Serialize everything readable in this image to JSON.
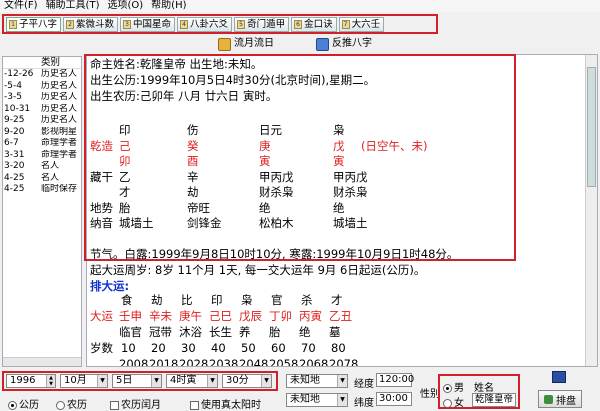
{
  "menu": [
    "文件(F)",
    "辅助工具(T)",
    "选项(O)",
    "帮助(H)"
  ],
  "tabs": [
    {
      "label": "子平八字",
      "num": "1"
    },
    {
      "label": "紫微斗数",
      "num": "2"
    },
    {
      "label": "中国星命",
      "num": "3"
    },
    {
      "label": "八卦六爻",
      "num": "4"
    },
    {
      "label": "奇门遁甲",
      "num": "5"
    },
    {
      "label": "金口诀",
      "num": "6"
    },
    {
      "label": "大六壬",
      "num": "7"
    }
  ],
  "subtoolbar": {
    "flow_label": "流月流日",
    "reverse_label": "反推八字"
  },
  "left_panel": {
    "header": "类别",
    "rows": [
      {
        "date": "-12-26",
        "cat": "历史名人"
      },
      {
        "date": "-5-4",
        "cat": "历史名人"
      },
      {
        "date": "-3-5",
        "cat": "历史名人"
      },
      {
        "date": "10-31",
        "cat": "历史名人"
      },
      {
        "date": "9-25",
        "cat": "历史名人"
      },
      {
        "date": "9-20",
        "cat": "影视明星"
      },
      {
        "date": "6-7",
        "cat": "命理学者"
      },
      {
        "date": "3-31",
        "cat": "命理学者"
      },
      {
        "date": "3-20",
        "cat": "名人"
      },
      {
        "date": "4-25",
        "cat": "名人"
      },
      {
        "date": "4-25",
        "cat": "临时保存"
      }
    ]
  },
  "chart": {
    "line1": "命主姓名:乾隆皇帝  出生地:未知。",
    "line2": "出生公历:1999年10月5日4时30分(北京时间),星期二。",
    "line3": "出生农历:己卯年 八月 廿六日 寅时。",
    "ten_gods": [
      "印",
      "伤",
      "日元",
      "枭"
    ],
    "qianzao_label": "乾造",
    "stems": [
      "己",
      "癸",
      "庚",
      "戊"
    ],
    "kong": "(日空午、未)",
    "branches": [
      "卯",
      "酉",
      "寅",
      "寅"
    ],
    "canggan_label": "藏干",
    "hidden_stems": [
      "乙",
      "辛",
      "甲丙戊",
      "甲丙戊"
    ],
    "hidden_gods": [
      "才",
      "劫",
      "财杀枭",
      "财杀枭"
    ],
    "dishi_label": "地势",
    "dishi": [
      "胎",
      "帝旺",
      "绝",
      "绝"
    ],
    "nayin_label": "纳音",
    "nayin": [
      "城墙土",
      "剑锋金",
      "松柏木",
      "城墙土"
    ],
    "jieqi": "节气。白露:1999年9月8日10时10分, 寒露:1999年10月9日1时48分。",
    "qiyun": "起大运周岁: 8岁 11个月 1天, 每一交大运年 9月 6日起运(公历)。",
    "dayun_label": "排大运:",
    "dayun_gods": [
      "食",
      "劫",
      "比",
      "印",
      "枭",
      "官",
      "杀",
      "才"
    ],
    "dayun_label2": "大运",
    "dayun_pillars": [
      "壬申",
      "辛未",
      "庚午",
      "己巳",
      "戊辰",
      "丁卯",
      "丙寅",
      "乙丑"
    ],
    "dayun_dishi": [
      "临官",
      "冠带",
      "沐浴",
      "长生",
      "养",
      "胎",
      "绝",
      "墓"
    ],
    "suishu_label": "岁数",
    "suishu": [
      "10",
      "20",
      "30",
      "40",
      "50",
      "60",
      "70",
      "80"
    ],
    "years": [
      "2008",
      "2018",
      "2028",
      "2038",
      "2048",
      "2058",
      "2068",
      "2078"
    ]
  },
  "date_inputs": {
    "year": "1996",
    "month": "10月",
    "day": "5日",
    "hour": "4时寅",
    "minute": "30分"
  },
  "calendar": {
    "solar": "公历",
    "lunar": "农历",
    "leap": "农历闰月",
    "true_solar": "使用真太阳时"
  },
  "location": {
    "place1": "未知地",
    "place2": "未知地",
    "lon_label": "经度",
    "lon": "120:00",
    "lat_label": "纬度",
    "lat": "30:00"
  },
  "gender": {
    "label": "性别",
    "male": "男",
    "female": "女",
    "name_label": "姓名",
    "name": "乾隆皇帝"
  },
  "actions": {
    "paipan": "排盘"
  }
}
